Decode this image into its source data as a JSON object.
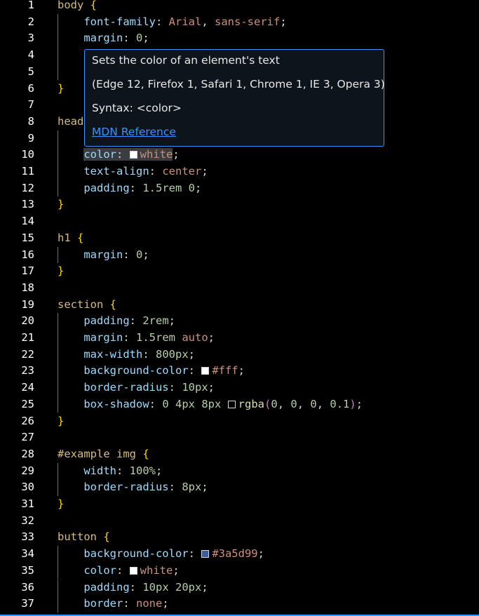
{
  "editor": {
    "lines": [
      {
        "n": 1,
        "guide": false,
        "tokens": [
          [
            "sel",
            "body"
          ],
          [
            "sp",
            " "
          ],
          [
            "brace",
            "{"
          ]
        ]
      },
      {
        "n": 2,
        "guide": true,
        "tokens": [
          [
            "sp",
            "    "
          ],
          [
            "prop",
            "font-family"
          ],
          [
            "punc",
            ": "
          ],
          [
            "val",
            "Arial"
          ],
          [
            "punc",
            ", "
          ],
          [
            "val",
            "sans-serif"
          ],
          [
            "punc",
            ";"
          ]
        ]
      },
      {
        "n": 3,
        "guide": true,
        "tokens": [
          [
            "sp",
            "    "
          ],
          [
            "prop",
            "margin"
          ],
          [
            "punc",
            ": "
          ],
          [
            "num",
            "0"
          ],
          [
            "punc",
            ";"
          ]
        ]
      },
      {
        "n": 4,
        "guide": true,
        "tokens": []
      },
      {
        "n": 5,
        "guide": true,
        "tokens": []
      },
      {
        "n": 6,
        "guide": false,
        "tokens": [
          [
            "brace",
            "}"
          ]
        ]
      },
      {
        "n": 7,
        "guide": false,
        "tokens": []
      },
      {
        "n": 8,
        "guide": false,
        "tokens": [
          [
            "sel",
            "head"
          ]
        ]
      },
      {
        "n": 9,
        "guide": true,
        "tokens": []
      },
      {
        "n": 10,
        "guide": true,
        "tokens": [
          [
            "sp",
            "    "
          ],
          [
            "hlprop",
            "color"
          ],
          [
            "hlpunc",
            ": "
          ],
          [
            "hlswatch",
            "#ffffff"
          ],
          [
            "hlval",
            "white"
          ],
          [
            "punc",
            ";"
          ]
        ]
      },
      {
        "n": 11,
        "guide": true,
        "tokens": [
          [
            "sp",
            "    "
          ],
          [
            "prop",
            "text-align"
          ],
          [
            "punc",
            ": "
          ],
          [
            "val",
            "center"
          ],
          [
            "punc",
            ";"
          ]
        ]
      },
      {
        "n": 12,
        "guide": true,
        "tokens": [
          [
            "sp",
            "    "
          ],
          [
            "prop",
            "padding"
          ],
          [
            "punc",
            ": "
          ],
          [
            "num",
            "1.5rem 0"
          ],
          [
            "punc",
            ";"
          ]
        ]
      },
      {
        "n": 13,
        "guide": false,
        "tokens": [
          [
            "brace",
            "}"
          ]
        ]
      },
      {
        "n": 14,
        "guide": false,
        "tokens": []
      },
      {
        "n": 15,
        "guide": false,
        "tokens": [
          [
            "sel",
            "h1"
          ],
          [
            "sp",
            " "
          ],
          [
            "brace",
            "{"
          ]
        ]
      },
      {
        "n": 16,
        "guide": true,
        "tokens": [
          [
            "sp",
            "    "
          ],
          [
            "prop",
            "margin"
          ],
          [
            "punc",
            ": "
          ],
          [
            "num",
            "0"
          ],
          [
            "punc",
            ";"
          ]
        ]
      },
      {
        "n": 17,
        "guide": false,
        "tokens": [
          [
            "brace",
            "}"
          ]
        ]
      },
      {
        "n": 18,
        "guide": false,
        "tokens": []
      },
      {
        "n": 19,
        "guide": false,
        "tokens": [
          [
            "sel",
            "section"
          ],
          [
            "sp",
            " "
          ],
          [
            "brace",
            "{"
          ]
        ]
      },
      {
        "n": 20,
        "guide": true,
        "tokens": [
          [
            "sp",
            "    "
          ],
          [
            "prop",
            "padding"
          ],
          [
            "punc",
            ": "
          ],
          [
            "num",
            "2rem"
          ],
          [
            "punc",
            ";"
          ]
        ]
      },
      {
        "n": 21,
        "guide": true,
        "tokens": [
          [
            "sp",
            "    "
          ],
          [
            "prop",
            "margin"
          ],
          [
            "punc",
            ": "
          ],
          [
            "num",
            "1.5rem"
          ],
          [
            "sp",
            " "
          ],
          [
            "val",
            "auto"
          ],
          [
            "punc",
            ";"
          ]
        ]
      },
      {
        "n": 22,
        "guide": true,
        "tokens": [
          [
            "sp",
            "    "
          ],
          [
            "prop",
            "max-width"
          ],
          [
            "punc",
            ": "
          ],
          [
            "num",
            "800px"
          ],
          [
            "punc",
            ";"
          ]
        ]
      },
      {
        "n": 23,
        "guide": true,
        "tokens": [
          [
            "sp",
            "    "
          ],
          [
            "prop",
            "background-color"
          ],
          [
            "punc",
            ": "
          ],
          [
            "swatch",
            "#ffffff"
          ],
          [
            "val",
            "#fff"
          ],
          [
            "punc",
            ";"
          ]
        ]
      },
      {
        "n": 24,
        "guide": true,
        "tokens": [
          [
            "sp",
            "    "
          ],
          [
            "prop",
            "border-radius"
          ],
          [
            "punc",
            ": "
          ],
          [
            "num",
            "10px"
          ],
          [
            "punc",
            ";"
          ]
        ]
      },
      {
        "n": 25,
        "guide": true,
        "tokens": [
          [
            "sp",
            "    "
          ],
          [
            "prop",
            "box-shadow"
          ],
          [
            "punc",
            ": "
          ],
          [
            "num",
            "0 4px 8px"
          ],
          [
            "sp",
            " "
          ],
          [
            "swatch",
            "#000000"
          ],
          [
            "fn",
            "rgba"
          ],
          [
            "paren",
            "("
          ],
          [
            "num",
            "0"
          ],
          [
            "punc",
            ", "
          ],
          [
            "num",
            "0"
          ],
          [
            "punc",
            ", "
          ],
          [
            "num",
            "0"
          ],
          [
            "punc",
            ", "
          ],
          [
            "num",
            "0.1"
          ],
          [
            "paren",
            ")"
          ],
          [
            "punc",
            ";"
          ]
        ]
      },
      {
        "n": 26,
        "guide": false,
        "tokens": [
          [
            "brace",
            "}"
          ]
        ]
      },
      {
        "n": 27,
        "guide": false,
        "tokens": []
      },
      {
        "n": 28,
        "guide": false,
        "tokens": [
          [
            "sel",
            "#example img"
          ],
          [
            "sp",
            " "
          ],
          [
            "brace",
            "{"
          ]
        ]
      },
      {
        "n": 29,
        "guide": true,
        "tokens": [
          [
            "sp",
            "    "
          ],
          [
            "prop",
            "width"
          ],
          [
            "punc",
            ": "
          ],
          [
            "num",
            "100%"
          ],
          [
            "punc",
            ";"
          ]
        ]
      },
      {
        "n": 30,
        "guide": true,
        "tokens": [
          [
            "sp",
            "    "
          ],
          [
            "prop",
            "border-radius"
          ],
          [
            "punc",
            ": "
          ],
          [
            "num",
            "8px"
          ],
          [
            "punc",
            ";"
          ]
        ]
      },
      {
        "n": 31,
        "guide": false,
        "tokens": [
          [
            "brace",
            "}"
          ]
        ]
      },
      {
        "n": 32,
        "guide": false,
        "tokens": []
      },
      {
        "n": 33,
        "guide": false,
        "tokens": [
          [
            "sel",
            "button"
          ],
          [
            "sp",
            " "
          ],
          [
            "brace",
            "{"
          ]
        ]
      },
      {
        "n": 34,
        "guide": true,
        "tokens": [
          [
            "sp",
            "    "
          ],
          [
            "prop",
            "background-color"
          ],
          [
            "punc",
            ": "
          ],
          [
            "swatch",
            "#3a5d99"
          ],
          [
            "val",
            "#3a5d99"
          ],
          [
            "punc",
            ";"
          ]
        ]
      },
      {
        "n": 35,
        "guide": true,
        "tokens": [
          [
            "sp",
            "    "
          ],
          [
            "prop",
            "color"
          ],
          [
            "punc",
            ": "
          ],
          [
            "swatch",
            "#ffffff"
          ],
          [
            "val",
            "white"
          ],
          [
            "punc",
            ";"
          ]
        ]
      },
      {
        "n": 36,
        "guide": true,
        "tokens": [
          [
            "sp",
            "    "
          ],
          [
            "prop",
            "padding"
          ],
          [
            "punc",
            ": "
          ],
          [
            "num",
            "10px 20px"
          ],
          [
            "punc",
            ";"
          ]
        ]
      },
      {
        "n": 37,
        "guide": true,
        "tokens": [
          [
            "sp",
            "    "
          ],
          [
            "prop",
            "border"
          ],
          [
            "punc",
            ": "
          ],
          [
            "val",
            "none"
          ],
          [
            "punc",
            ";"
          ]
        ]
      }
    ]
  },
  "hover": {
    "description": "Sets the color of an element's text",
    "compat": "(Edge 12, Firefox 1, Safari 1, Chrome 1, IE 3, Opera 3)",
    "syntax": "Syntax: <color>",
    "link_label": "MDN Reference"
  },
  "colors": {
    "accent": "#3794ff",
    "background": "#000000"
  }
}
